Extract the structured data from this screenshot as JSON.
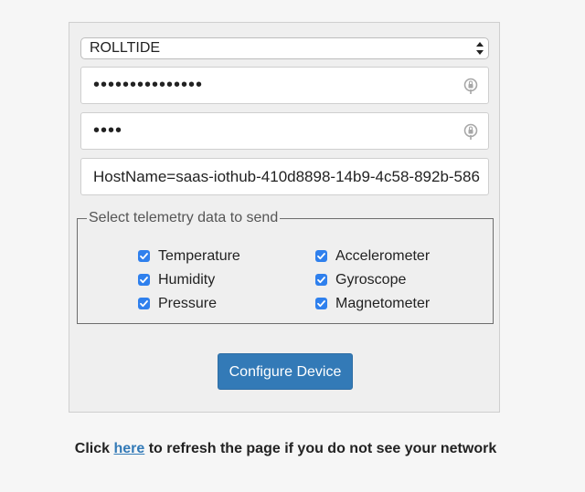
{
  "form": {
    "network_select": {
      "selected": "ROLLTIDE"
    },
    "wifi_password": {
      "value": "•••••••••••••••"
    },
    "device_password": {
      "value": "••••"
    },
    "connection_string": {
      "value": "HostName=saas-iothub-410d8898-14b9-4c58-892b-586"
    },
    "telemetry": {
      "legend": "Select telemetry data to send",
      "options": [
        {
          "label": "Temperature",
          "checked": true
        },
        {
          "label": "Humidity",
          "checked": true
        },
        {
          "label": "Pressure",
          "checked": true
        },
        {
          "label": "Accelerometer",
          "checked": true
        },
        {
          "label": "Gyroscope",
          "checked": true
        },
        {
          "label": "Magnetometer",
          "checked": true
        }
      ]
    },
    "submit_label": "Configure Device"
  },
  "footer": {
    "prefix": "Click",
    "link_text": "here",
    "suffix": "to refresh the page if you do not see your network"
  },
  "colors": {
    "accent": "#337ab7",
    "checkbox": "#2f80ed"
  }
}
